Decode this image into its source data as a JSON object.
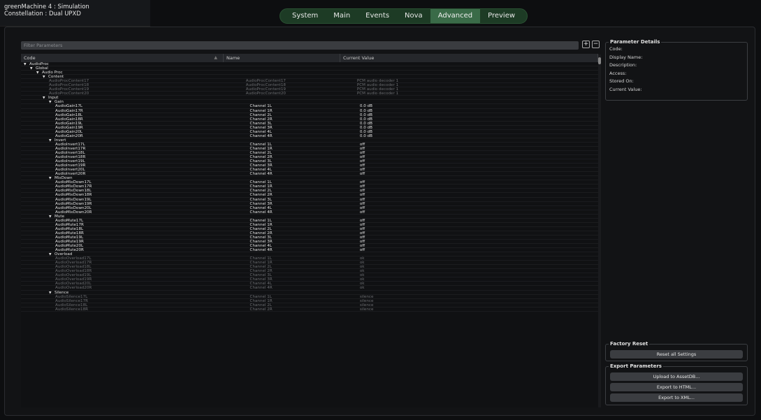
{
  "app": {
    "title_line1": "greenMachine 4 : Simulation",
    "title_line2": "Constellation : Dual UPXD"
  },
  "tabs": [
    {
      "label": "System",
      "active": false
    },
    {
      "label": "Main",
      "active": false
    },
    {
      "label": "Events",
      "active": false
    },
    {
      "label": "Nova",
      "active": false
    },
    {
      "label": "Advanced",
      "active": true
    },
    {
      "label": "Preview",
      "active": false
    }
  ],
  "filter": {
    "placeholder": "Filter Parameters"
  },
  "table": {
    "headers": {
      "code": "Code",
      "name": "Name",
      "value": "Current Value"
    },
    "rows": [
      {
        "level": 0,
        "group": true,
        "code": "AudioProc",
        "name": "",
        "value": ""
      },
      {
        "level": 1,
        "group": true,
        "code": "Global",
        "name": "",
        "value": ""
      },
      {
        "level": 2,
        "group": true,
        "code": "Audio Proc",
        "name": "",
        "value": ""
      },
      {
        "level": 3,
        "group": true,
        "code": "Content",
        "name": "",
        "value": ""
      },
      {
        "level": 4,
        "dim": true,
        "code": "AudioProcContent17",
        "name": "AudioProcContent17",
        "value": "PCM audio decoder 1"
      },
      {
        "level": 4,
        "dim": true,
        "code": "AudioProcContent18",
        "name": "AudioProcContent18",
        "value": "PCM audio decoder 1"
      },
      {
        "level": 4,
        "dim": true,
        "code": "AudioProcContent19",
        "name": "AudioProcContent19",
        "value": "PCM audio decoder 1"
      },
      {
        "level": 4,
        "dim": true,
        "code": "AudioProcContent20",
        "name": "AudioProcContent20",
        "value": "PCM audio decoder 1"
      },
      {
        "level": 3,
        "group": true,
        "code": "Input",
        "name": "",
        "value": ""
      },
      {
        "level": 4,
        "group": true,
        "code": "Gain",
        "name": "",
        "value": ""
      },
      {
        "level": 5,
        "code": "AudioGain17L",
        "name": "Channel 1L",
        "value": "0.0 dB"
      },
      {
        "level": 5,
        "code": "AudioGain17R",
        "name": "Channel 1R",
        "value": "0.0 dB"
      },
      {
        "level": 5,
        "code": "AudioGain18L",
        "name": "Channel 2L",
        "value": "0.0 dB"
      },
      {
        "level": 5,
        "code": "AudioGain18R",
        "name": "Channel 2R",
        "value": "0.0 dB"
      },
      {
        "level": 5,
        "code": "AudioGain19L",
        "name": "Channel 3L",
        "value": "0.0 dB"
      },
      {
        "level": 5,
        "code": "AudioGain19R",
        "name": "Channel 3R",
        "value": "0.0 dB"
      },
      {
        "level": 5,
        "code": "AudioGain20L",
        "name": "Channel 4L",
        "value": "0.0 dB"
      },
      {
        "level": 5,
        "code": "AudioGain20R",
        "name": "Channel 4R",
        "value": "0.0 dB"
      },
      {
        "level": 4,
        "group": true,
        "code": "Invert",
        "name": "",
        "value": ""
      },
      {
        "level": 5,
        "code": "AudioInvert17L",
        "name": "Channel 1L",
        "value": "off"
      },
      {
        "level": 5,
        "code": "AudioInvert17R",
        "name": "Channel 1R",
        "value": "off"
      },
      {
        "level": 5,
        "code": "AudioInvert18L",
        "name": "Channel 2L",
        "value": "off"
      },
      {
        "level": 5,
        "code": "AudioInvert18R",
        "name": "Channel 2R",
        "value": "off"
      },
      {
        "level": 5,
        "code": "AudioInvert19L",
        "name": "Channel 3L",
        "value": "off"
      },
      {
        "level": 5,
        "code": "AudioInvert19R",
        "name": "Channel 3R",
        "value": "off"
      },
      {
        "level": 5,
        "code": "AudioInvert20L",
        "name": "Channel 4L",
        "value": "off"
      },
      {
        "level": 5,
        "code": "AudioInvert20R",
        "name": "Channel 4R",
        "value": "off"
      },
      {
        "level": 4,
        "group": true,
        "code": "MixDown",
        "name": "",
        "value": ""
      },
      {
        "level": 5,
        "code": "AudioMixDown17L",
        "name": "Channel 1L",
        "value": "off"
      },
      {
        "level": 5,
        "code": "AudioMixDown17R",
        "name": "Channel 1R",
        "value": "off"
      },
      {
        "level": 5,
        "code": "AudioMixDown18L",
        "name": "Channel 2L",
        "value": "off"
      },
      {
        "level": 5,
        "code": "AudioMixDown18R",
        "name": "Channel 2R",
        "value": "off"
      },
      {
        "level": 5,
        "code": "AudioMixDown19L",
        "name": "Channel 3L",
        "value": "off"
      },
      {
        "level": 5,
        "code": "AudioMixDown19R",
        "name": "Channel 3R",
        "value": "off"
      },
      {
        "level": 5,
        "code": "AudioMixDown20L",
        "name": "Channel 4L",
        "value": "off"
      },
      {
        "level": 5,
        "code": "AudioMixDown20R",
        "name": "Channel 4R",
        "value": "off"
      },
      {
        "level": 4,
        "group": true,
        "code": "Mute",
        "name": "",
        "value": ""
      },
      {
        "level": 5,
        "code": "AudioMute17L",
        "name": "Channel 1L",
        "value": "off"
      },
      {
        "level": 5,
        "code": "AudioMute17R",
        "name": "Channel 1R",
        "value": "off"
      },
      {
        "level": 5,
        "code": "AudioMute18L",
        "name": "Channel 2L",
        "value": "off"
      },
      {
        "level": 5,
        "code": "AudioMute18R",
        "name": "Channel 2R",
        "value": "off"
      },
      {
        "level": 5,
        "code": "AudioMute19L",
        "name": "Channel 3L",
        "value": "off"
      },
      {
        "level": 5,
        "code": "AudioMute19R",
        "name": "Channel 3R",
        "value": "off"
      },
      {
        "level": 5,
        "code": "AudioMute20L",
        "name": "Channel 4L",
        "value": "off"
      },
      {
        "level": 5,
        "code": "AudioMute20R",
        "name": "Channel 4R",
        "value": "off"
      },
      {
        "level": 4,
        "group": true,
        "code": "Overload",
        "name": "",
        "value": ""
      },
      {
        "level": 5,
        "dim": true,
        "code": "AudioOverload17L",
        "name": "Channel 1L",
        "value": "ok"
      },
      {
        "level": 5,
        "dim": true,
        "code": "AudioOverload17R",
        "name": "Channel 1R",
        "value": "ok"
      },
      {
        "level": 5,
        "dim": true,
        "code": "AudioOverload18L",
        "name": "Channel 2L",
        "value": "ok"
      },
      {
        "level": 5,
        "dim": true,
        "code": "AudioOverload18R",
        "name": "Channel 2R",
        "value": "ok"
      },
      {
        "level": 5,
        "dim": true,
        "code": "AudioOverload19L",
        "name": "Channel 3L",
        "value": "ok"
      },
      {
        "level": 5,
        "dim": true,
        "code": "AudioOverload19R",
        "name": "Channel 3R",
        "value": "ok"
      },
      {
        "level": 5,
        "dim": true,
        "code": "AudioOverload20L",
        "name": "Channel 4L",
        "value": "ok"
      },
      {
        "level": 5,
        "dim": true,
        "code": "AudioOverload20R",
        "name": "Channel 4R",
        "value": "ok"
      },
      {
        "level": 4,
        "group": true,
        "code": "Silence",
        "name": "",
        "value": ""
      },
      {
        "level": 5,
        "dim": true,
        "code": "AudioSilence17L",
        "name": "Channel 1L",
        "value": "silence"
      },
      {
        "level": 5,
        "dim": true,
        "code": "AudioSilence17R",
        "name": "Channel 1R",
        "value": "silence"
      },
      {
        "level": 5,
        "dim": true,
        "code": "AudioSilence18L",
        "name": "Channel 2L",
        "value": "silence"
      },
      {
        "level": 5,
        "dim": true,
        "code": "AudioSilence18R",
        "name": "Channel 2R",
        "value": "silence"
      }
    ]
  },
  "details": {
    "title": "Parameter Details",
    "labels": [
      "Code:",
      "Display Name:",
      "Description:",
      "Access:",
      "Stored On:",
      "Current Value:"
    ]
  },
  "factory_reset": {
    "title": "Factory Reset",
    "button": "Reset all Settings"
  },
  "export": {
    "title": "Export Parameters",
    "buttons": [
      "Upload to AssetDB...",
      "Export to HTML...",
      "Export to XML..."
    ]
  },
  "colors": {
    "tab_bar": "#1d3b25",
    "tab_active": "#3a6b48",
    "background": "#0d0e10",
    "panel": "#121315"
  },
  "icons": {
    "expand_all": "plus-box-icon",
    "collapse_all": "minus-box-icon",
    "tree_expanded": "triangle-down-icon"
  }
}
